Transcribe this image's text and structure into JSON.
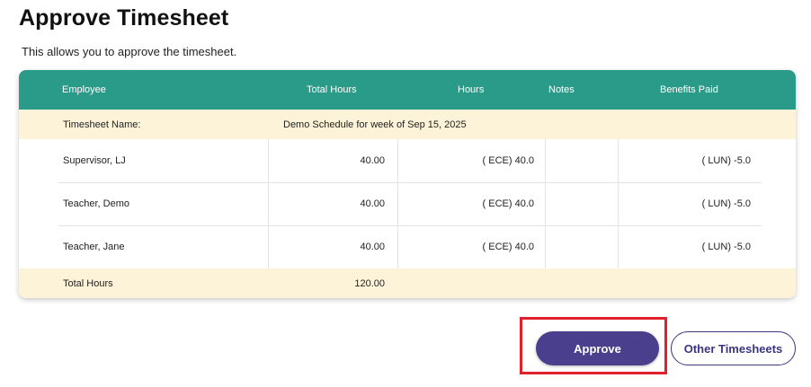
{
  "page": {
    "title": "Approve Timesheet",
    "subtitle": "This allows you to approve the timesheet."
  },
  "table": {
    "headers": {
      "employee": "Employee",
      "total_hours": "Total Hours",
      "hours": "Hours",
      "notes": "Notes",
      "benefits_paid": "Benefits Paid"
    },
    "timesheet_name_label": "Timesheet Name:",
    "timesheet_name_value": "Demo Schedule for week of Sep 15, 2025",
    "rows": [
      {
        "employee": "Supervisor, LJ",
        "total_hours": "40.00",
        "hours": "( ECE) 40.0",
        "notes": "",
        "benefits_paid": "( LUN) -5.0"
      },
      {
        "employee": "Teacher, Demo",
        "total_hours": "40.00",
        "hours": "( ECE) 40.0",
        "notes": "",
        "benefits_paid": "( LUN) -5.0"
      },
      {
        "employee": "Teacher, Jane",
        "total_hours": "40.00",
        "hours": "( ECE) 40.0",
        "notes": "",
        "benefits_paid": "( LUN) -5.0"
      }
    ],
    "total_label": "Total Hours",
    "total_value": "120.00"
  },
  "actions": {
    "approve_label": "Approve",
    "other_timesheets_label": "Other Timesheets"
  },
  "colors": {
    "header_bg": "#2a9b88",
    "highlight_row_bg": "#fdf3d8",
    "primary_button": "#4a3f8c",
    "annotation_box": "#e0202a"
  }
}
